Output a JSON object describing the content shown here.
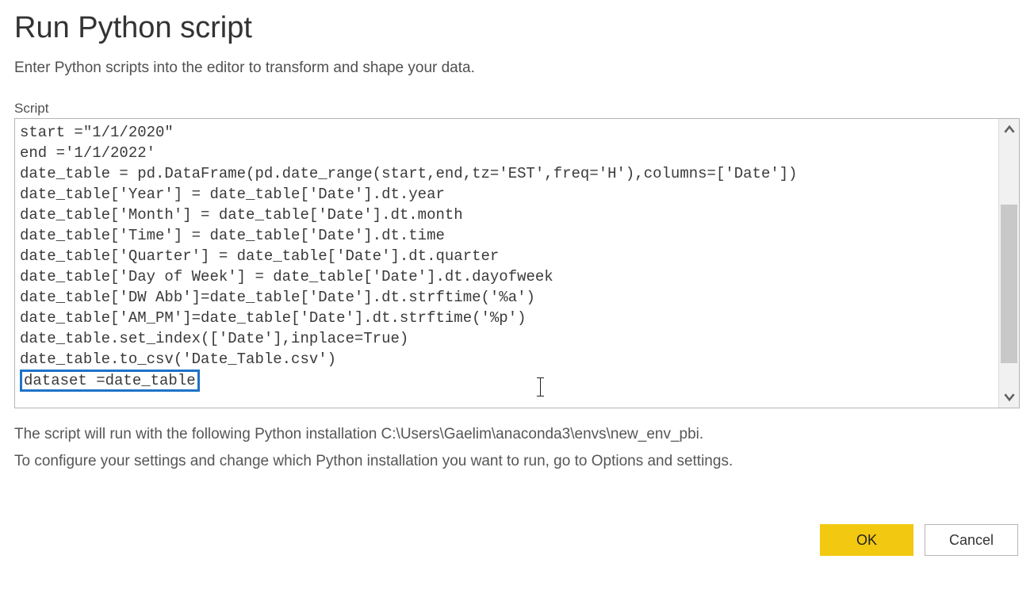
{
  "dialog": {
    "title": "Run Python script",
    "subtitle": "Enter Python scripts into the editor to transform and shape your data.",
    "script_label": "Script",
    "script_lines": [
      "start =\"1/1/2020\"",
      "end ='1/1/2022'",
      "date_table = pd.DataFrame(pd.date_range(start,end,tz='EST',freq='H'),columns=['Date'])",
      "date_table['Year'] = date_table['Date'].dt.year",
      "date_table['Month'] = date_table['Date'].dt.month",
      "date_table['Time'] = date_table['Date'].dt.time",
      "date_table['Quarter'] = date_table['Date'].dt.quarter",
      "date_table['Day of Week'] = date_table['Date'].dt.dayofweek",
      "date_table['DW Abb']=date_table['Date'].dt.strftime('%a')",
      "date_table['AM_PM']=date_table['Date'].dt.strftime('%p')",
      "date_table.set_index(['Date'],inplace=True)",
      "date_table.to_csv('Date_Table.csv')"
    ],
    "highlighted_line": "dataset =date_table",
    "info_line1": "The script will run with the following Python installation C:\\Users\\Gaelim\\anaconda3\\envs\\new_env_pbi.",
    "info_line2": "To configure your settings and change which Python installation you want to run, go to Options and settings.",
    "ok_label": "OK",
    "cancel_label": "Cancel"
  }
}
